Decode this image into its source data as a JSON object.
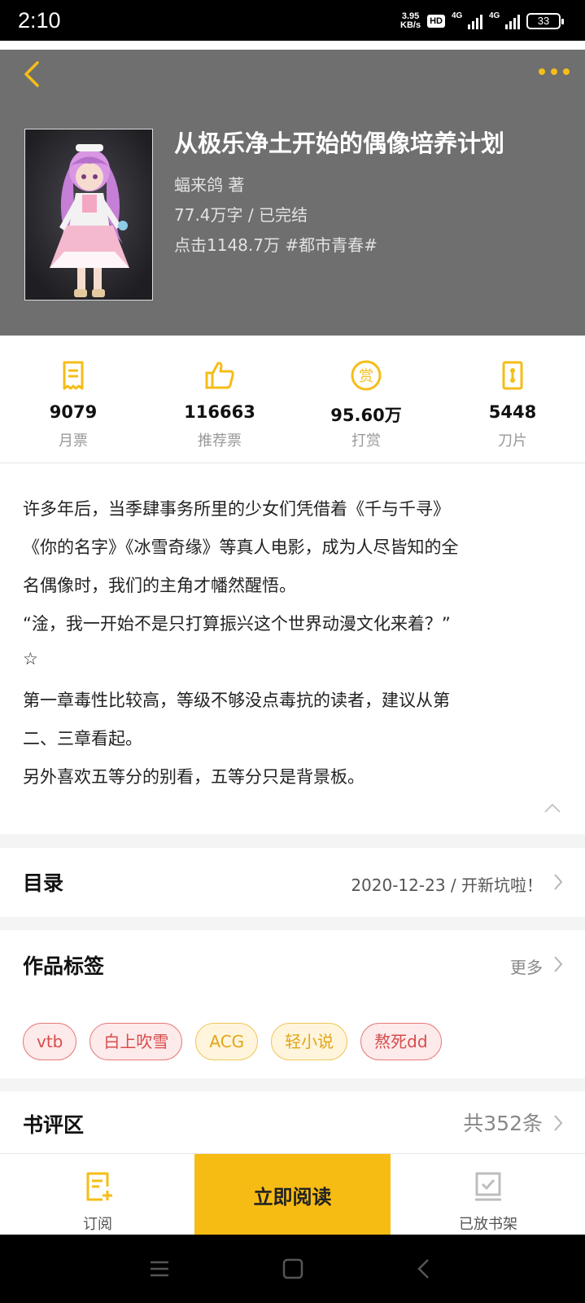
{
  "status_bar": {
    "time": "2:10",
    "net_speed_value": "3.95",
    "net_speed_unit": "KB/s",
    "hd_label": "HD",
    "signal1_label": "4G",
    "signal2_label": "4G",
    "battery": "33"
  },
  "book": {
    "title": "从极乐净土开始的偶像培养计划",
    "author": "蝠来鸽  著",
    "word_status": "77.4万字 / 已完结",
    "clicks_genre": "点击1148.7万  #都市青春#"
  },
  "stats": [
    {
      "value": "9079",
      "label": "月票",
      "icon": "monthly-ticket-icon"
    },
    {
      "value": "116663",
      "label": "推荐票",
      "icon": "thumbs-up-icon"
    },
    {
      "value": "95.60万",
      "label": "打赏",
      "icon": "reward-icon"
    },
    {
      "value": "5448",
      "label": "刀片",
      "icon": "blade-icon"
    }
  ],
  "description": [
    "许多年后，当季肆事务所里的少女们凭借着《千与千寻》",
    "《你的名字》《冰雪奇缘》等真人电影，成为人尽皆知的全",
    "名偶像时，我们的主角才幡然醒悟。",
    "“淦，我一开始不是只打算振兴这个世界动漫文化来着？”",
    "☆",
    "第一章毒性比较高，等级不够没点毒抗的读者，建议从第",
    "二、三章看起。",
    "另外喜欢五等分的别看，五等分只是背景板。"
  ],
  "catalog": {
    "title": "目录",
    "latest": "2020-12-23 / 开新坑啦！"
  },
  "tags_section": {
    "title": "作品标签",
    "more": "更多",
    "tags": [
      {
        "label": "vtb",
        "color": "#d84c4c"
      },
      {
        "label": "白上吹雪",
        "color": "#d84c4c"
      },
      {
        "label": "ACG",
        "color": "#e2a51a"
      },
      {
        "label": "轻小说",
        "color": "#e2a51a"
      },
      {
        "label": "熬死dd",
        "color": "#d84c4c"
      }
    ]
  },
  "reviews": {
    "title": "书评区",
    "count": "共352条"
  },
  "bottom_bar": {
    "subscribe": "订阅",
    "read_now": "立即阅读",
    "on_shelf": "已放书架"
  },
  "colors": {
    "accent": "#f7bc13",
    "header_bg": "#6f6f6f"
  }
}
